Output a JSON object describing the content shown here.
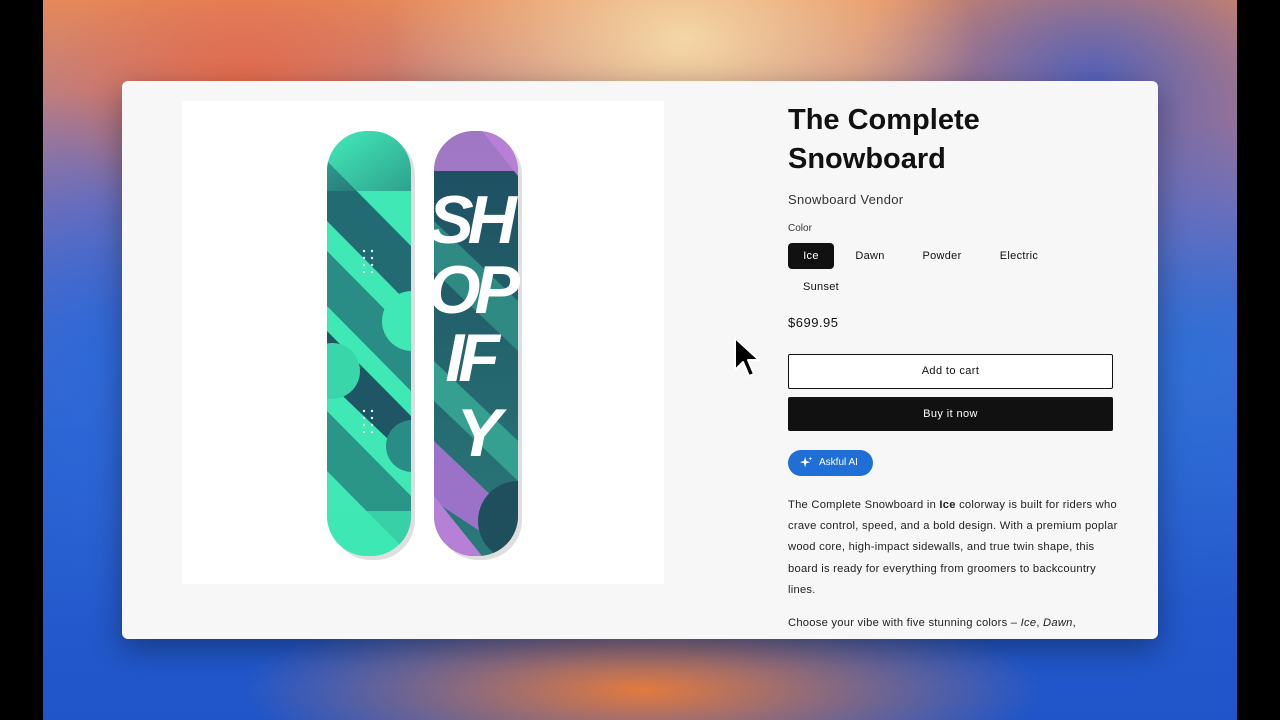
{
  "product": {
    "title": "The Complete Snowboard",
    "vendor": "Snowboard Vendor",
    "color_label": "Color",
    "colors": [
      "Ice",
      "Dawn",
      "Powder",
      "Electric",
      "Sunset"
    ],
    "selected_color": "Ice",
    "price": "$699.95",
    "add_to_cart": "Add to cart",
    "buy_now": "Buy it now",
    "ai_button": "Askful AI",
    "image_text": "SHOPIFY",
    "description": {
      "p1_before": "The Complete Snowboard in ",
      "p1_bold": "Ice",
      "p1_after": " colorway is built for riders who crave control, speed, and a bold design. With a premium poplar wood core, high-impact sidewalls, and true twin shape, this board is ready for everything from groomers to backcountry lines.",
      "p2_before": "Choose your vibe with five stunning colors – ",
      "p2_italic_1": "Ice",
      "p2_sep": ", ",
      "p2_italic_2": "Dawn",
      "p2_after": ","
    }
  },
  "icons": {
    "ai": "sparkle-icon",
    "pointer": "mouse-pointer-icon"
  },
  "theme": {
    "accent": "#1f6fd6",
    "dark": "#111111",
    "board_teal": "#3fe8b5",
    "board_purple": "#b77fd6"
  }
}
